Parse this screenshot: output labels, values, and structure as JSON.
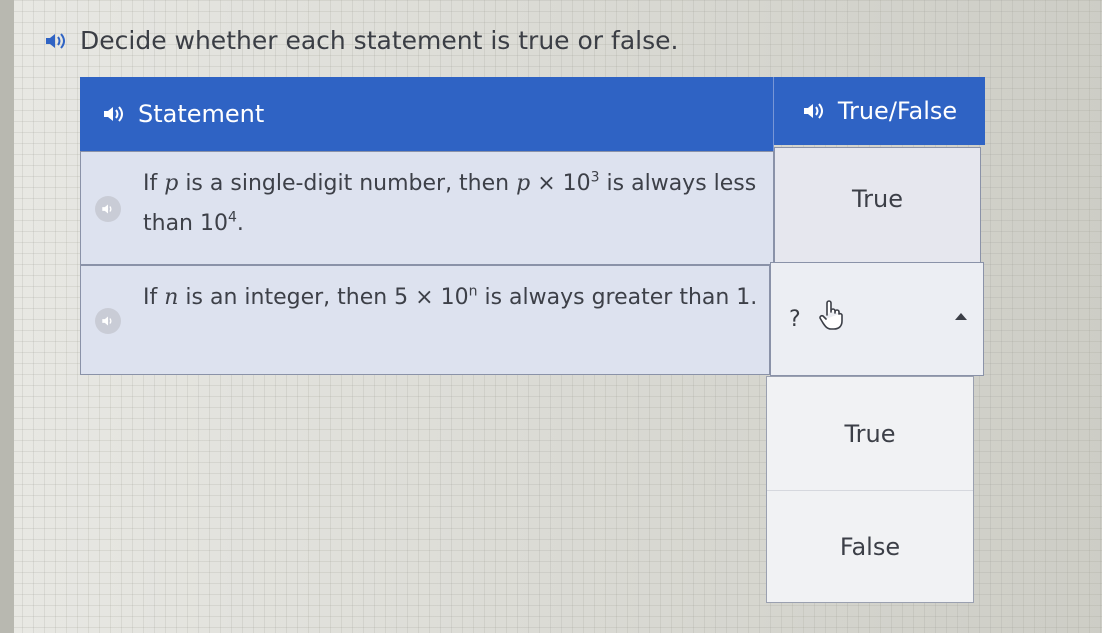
{
  "prompt": {
    "text": "Decide whether each statement is true or false."
  },
  "table": {
    "headers": {
      "statement": "Statement",
      "answer": "True/False"
    },
    "rows": [
      {
        "parts": [
          "If ",
          "p",
          " is a single-digit number, then ",
          "p",
          " × 10",
          "3",
          " is always less than 10",
          "4",
          "."
        ],
        "answer": "True"
      },
      {
        "parts": [
          "If ",
          "n",
          " is an integer, then 5 × 10",
          "n",
          " is always greater than 1."
        ],
        "answer": "?"
      }
    ]
  },
  "dropdown": {
    "options": [
      "True",
      "False"
    ]
  },
  "icons": {
    "speaker": "speaker-icon",
    "pointer": "hand-pointer-icon",
    "caret": "caret-up-icon"
  },
  "colors": {
    "header_bg": "#2f63c4",
    "row_bg": "#dde2ef"
  }
}
